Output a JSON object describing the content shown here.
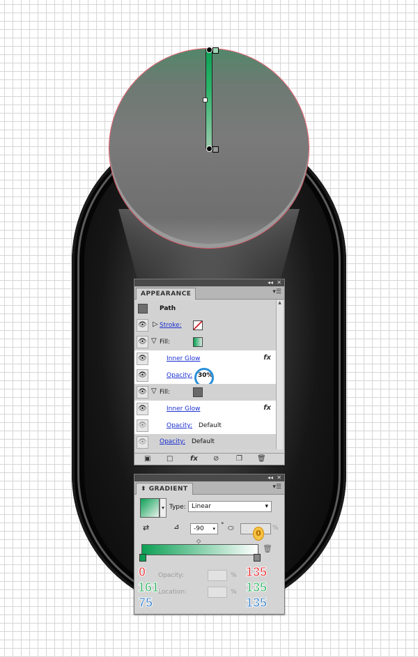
{
  "appearance": {
    "tab_title": "APPEARANCE",
    "object_type": "Path",
    "rows": [
      {
        "label": "Stroke:"
      },
      {
        "label": "Fill:"
      },
      {
        "label": "Inner Glow"
      },
      {
        "label": "Opacity:",
        "value": "30%"
      },
      {
        "label": "Fill:"
      },
      {
        "label": "Inner Glow"
      },
      {
        "label": "Opacity:",
        "value": "Default"
      },
      {
        "label": "Opacity:",
        "value": "Default"
      }
    ]
  },
  "gradient": {
    "tab_title": "GRADIENT",
    "type_label": "Type:",
    "type_value": "Linear",
    "angle_value": "-90",
    "degree_symbol": "°",
    "percent_symbol": "%",
    "opacity_label": "Opacity:",
    "location_label": "Location:",
    "aspect_badge": "0"
  },
  "rgb_annotations": {
    "left": {
      "r": "0",
      "g": "161",
      "b": "75"
    },
    "right": {
      "r": "135",
      "g": "135",
      "b": "135"
    }
  },
  "colors": {
    "red": "#e8232a",
    "green": "#1fae55",
    "blue": "#2a79c8",
    "accent_green": "#0da055"
  }
}
